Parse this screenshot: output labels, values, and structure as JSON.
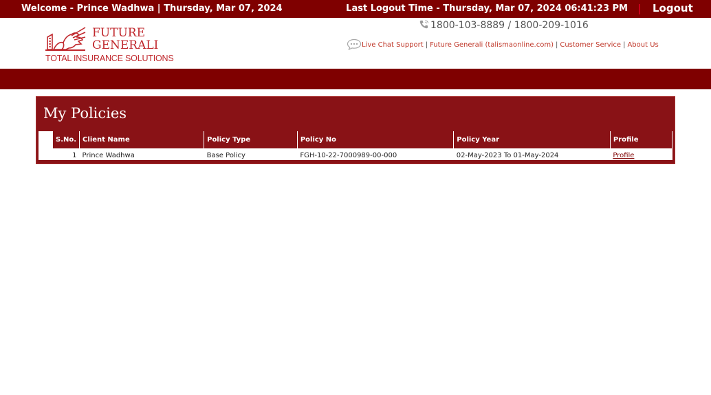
{
  "topbar": {
    "welcome": "Welcome - Prince Wadhwa | Thursday, Mar 07, 2024",
    "last_logout": "Last Logout Time - Thursday, Mar 07, 2024 06:41:23 PM",
    "logout_label": "Logout"
  },
  "header": {
    "logo": {
      "line1": "FUTURE",
      "line2": "GENERALI",
      "tagline": "TOTAL INSURANCE SOLUTIONS"
    },
    "phone": "1800-103-8889 / 1800-209-1016",
    "links": {
      "live_chat": "Live Chat Support",
      "future_generali": "Future Generali (talismaonline.com)",
      "customer_service": "Customer Service",
      "about_us": "About Us",
      "separator": "|"
    }
  },
  "policies": {
    "title": "My Policies",
    "columns": [
      "S.No.",
      "Client Name",
      "Policy Type",
      "Policy No",
      "Policy Year",
      "Profile"
    ],
    "rows": [
      {
        "sno": "1",
        "client_name": "Prince Wadhwa",
        "policy_type": "Base Policy",
        "policy_no": "FGH-10-22-7000989-00-000",
        "policy_year": "02-May-2023 To 01-May-2024",
        "profile": "Profile"
      }
    ]
  },
  "colors": {
    "brand_dark": "#7f0000",
    "panel": "#891216",
    "logo_red": "#c0282d",
    "link": "#c0392b"
  },
  "icons": [
    "phone-icon",
    "chat-icon",
    "lion-logo-icon"
  ]
}
